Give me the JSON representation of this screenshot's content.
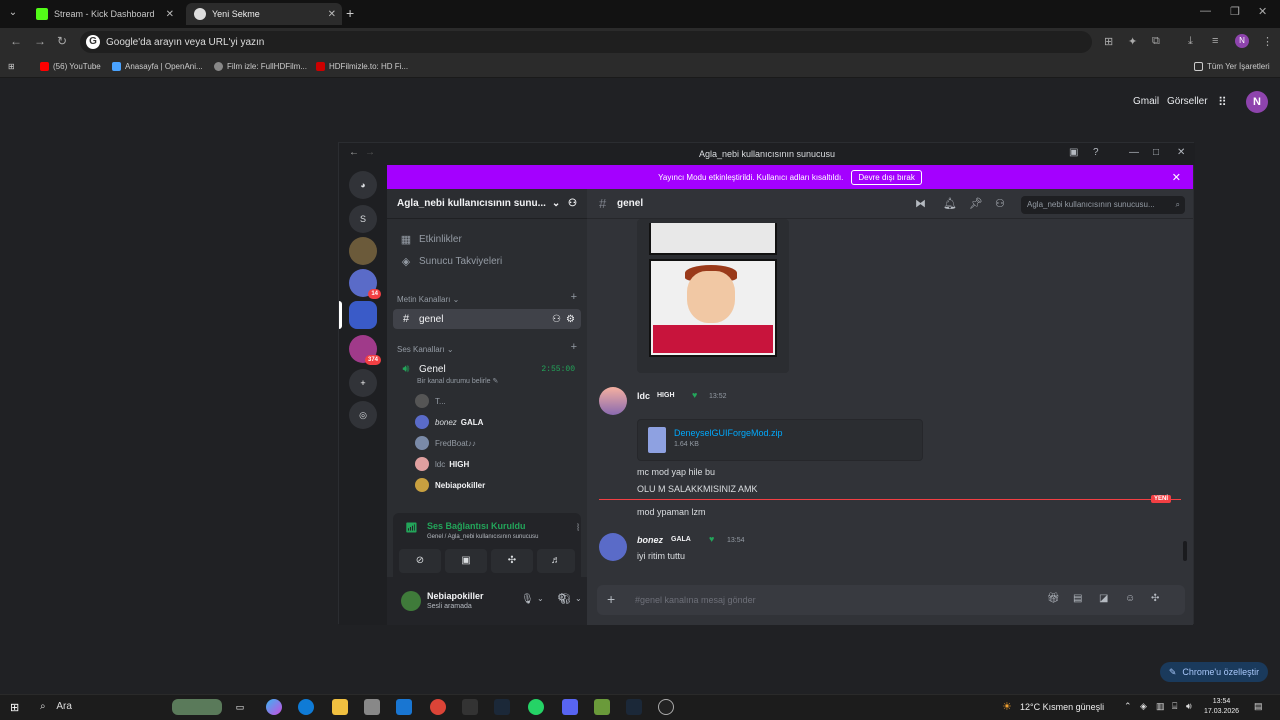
{
  "tabs": [
    {
      "label": "Stream - Kick Dashboard",
      "icon": "kick-icon",
      "color": "#53fc18"
    },
    {
      "label": "Yeni Sekme",
      "icon": "chrome-icon",
      "color": "#ffffff"
    }
  ],
  "omnibox": {
    "placeholder": "Google'da arayın veya URL'yi yazın"
  },
  "bookmarks": [
    {
      "label": "(56) YouTube",
      "color": "#ff0000"
    },
    {
      "label": "Anasayfa | OpenAni...",
      "color": "#4aa3ff"
    },
    {
      "label": "Film izle: FullHDFilm...",
      "color": "#888888"
    },
    {
      "label": "HDFilmizle.to: HD Fi...",
      "color": "#cc0000"
    }
  ],
  "bookmarks_all": "Tüm Yer İşaretleri",
  "ntp": {
    "gmail": "Gmail",
    "images": "Görseller",
    "avatar": "N",
    "customize": "Chrome'u özelleştir"
  },
  "discord": {
    "window_title": "Agla_nebi kullanıcısının sunucusu",
    "banner_text": "Yayıncı Modu etkinleştirildi. Kullanıcı adları kısaltıldı.",
    "banner_button": "Devre dışı bırak",
    "guild_s": "S",
    "guild_badges": [
      "14",
      "374"
    ],
    "server_name": "Agla_nebi kullanıcısının sunu...",
    "events": "Etkinlikler",
    "boosts": "Sunucu Takviyeleri",
    "text_category": "Metin Kanalları",
    "text_channel": "genel",
    "voice_category": "Ses Kanalları",
    "voice_channel": "Genel",
    "voice_timer": "2:55:00",
    "voice_status_prompt": "Bir kanal durumu belirle",
    "voice_users": [
      {
        "name": "T...",
        "tag": ""
      },
      {
        "name": "bonez",
        "tag": "GALA"
      },
      {
        "name": "FredBoat♪♪",
        "tag": ""
      },
      {
        "name": "ldc",
        "tag": "HIGH"
      },
      {
        "name": "Nebiapokiller",
        "tag": ""
      }
    ],
    "voice_connected": "Ses Bağlantısı Kuruldu",
    "voice_connected_sub": "Genel / Agla_nebi kullanıcısının sunucusu",
    "user_name": "Nebiapokiller",
    "user_status": "Sesli aramada",
    "channel_header": "genel",
    "search_placeholder": "Agla_nebi kullanıcısının sunucusu...",
    "messages": [
      {
        "author": "ldc",
        "tag": "HIGH",
        "time": "13:52",
        "attachment": {
          "name": "DeneyselGUIForgeMod.zip",
          "size": "1.64 KB"
        },
        "lines": [
          "mc mod yap hile bu",
          "OLU M SALAKKMISINIZ AMK"
        ]
      },
      {
        "author": "",
        "lines": [
          "mod ypaman lzm"
        ]
      },
      {
        "author": "bonez",
        "tag": "GALA",
        "time": "13:54",
        "lines": [
          "iyi ritim tuttu"
        ]
      }
    ],
    "new_badge": "YENİ",
    "composer_placeholder": "#genel kanalına mesaj gönder"
  },
  "taskbar": {
    "search": "Ara",
    "weather": "12°C  Kısmen güneşli",
    "time": "13:54",
    "date": "17.03.2026"
  }
}
